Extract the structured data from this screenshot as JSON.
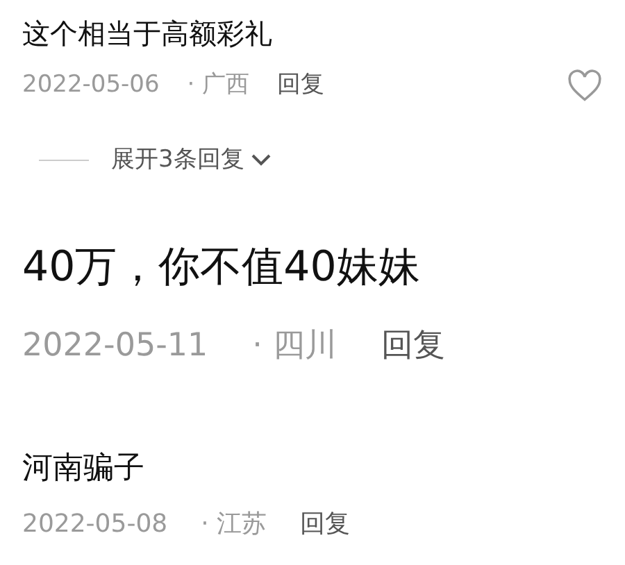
{
  "comments": [
    {
      "text": "这个相当于高额彩礼",
      "date": "2022-05-06",
      "region": "· 广西",
      "reply": "回复",
      "liked": false,
      "expand": "展开3条回复",
      "kind": "compact"
    },
    {
      "text": "40万，你不值40妹妹",
      "date": "2022-05-11",
      "region": "· 四川",
      "reply": "回复",
      "kind": "enlarged"
    },
    {
      "text": "河南骗子",
      "date": "2022-05-08",
      "region": "· 江苏",
      "reply": "回复",
      "kind": "regular"
    }
  ]
}
